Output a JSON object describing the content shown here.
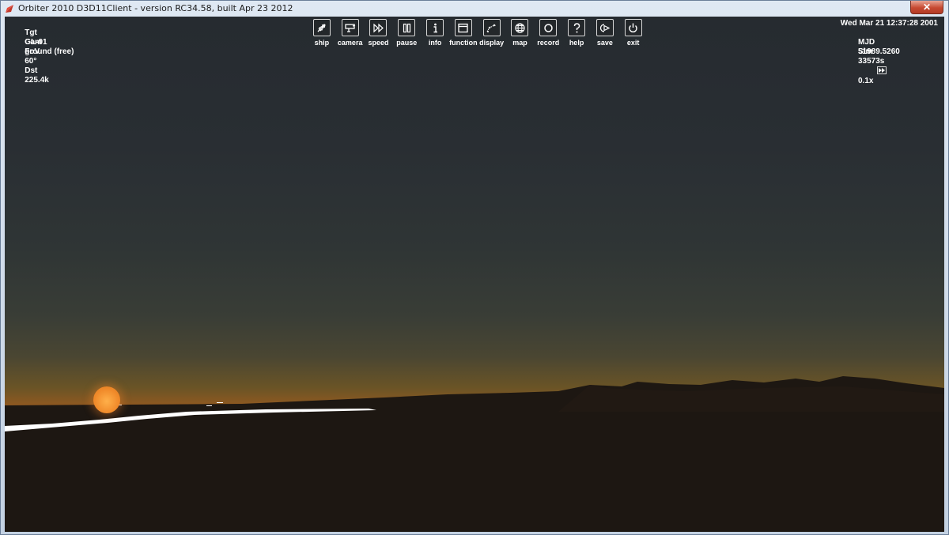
{
  "window": {
    "title": "Orbiter 2010 D3D11Client - version RC34.58, built Apr 23 2012",
    "close_symbol": "✕"
  },
  "hud_left": {
    "tgt_label": "Tgt",
    "tgt_value": "GL-01",
    "cam_label": "Cam",
    "cam_value": "ground (free)",
    "fov_label": "FoV",
    "fov_value": "60°",
    "dst_label": "Dst",
    "dst_value": "225.4k"
  },
  "hud_right": {
    "datetime": "Wed Mar 21 12:37:28 2001",
    "mjd_label": "MJD",
    "mjd_value": "51989.5260",
    "sim_label": "Sim",
    "sim_value": "33573s",
    "time_accel": "0.1x"
  },
  "toolbar": [
    {
      "label": "ship",
      "icon": "ship-icon"
    },
    {
      "label": "camera",
      "icon": "camera-icon"
    },
    {
      "label": "speed",
      "icon": "speed-icon"
    },
    {
      "label": "pause",
      "icon": "pause-icon"
    },
    {
      "label": "info",
      "icon": "info-icon"
    },
    {
      "label": "function",
      "icon": "function-icon"
    },
    {
      "label": "display",
      "icon": "display-icon"
    },
    {
      "label": "map",
      "icon": "globe-icon"
    },
    {
      "label": "record",
      "icon": "record-icon"
    },
    {
      "label": "help",
      "icon": "help-icon"
    },
    {
      "label": "save",
      "icon": "save-icon"
    },
    {
      "label": "exit",
      "icon": "power-icon"
    }
  ],
  "colors": {
    "sky_top": "#262b30",
    "horizon_glow": "#c45516",
    "sun": "#f08a2a",
    "ground": "#1e1510"
  }
}
